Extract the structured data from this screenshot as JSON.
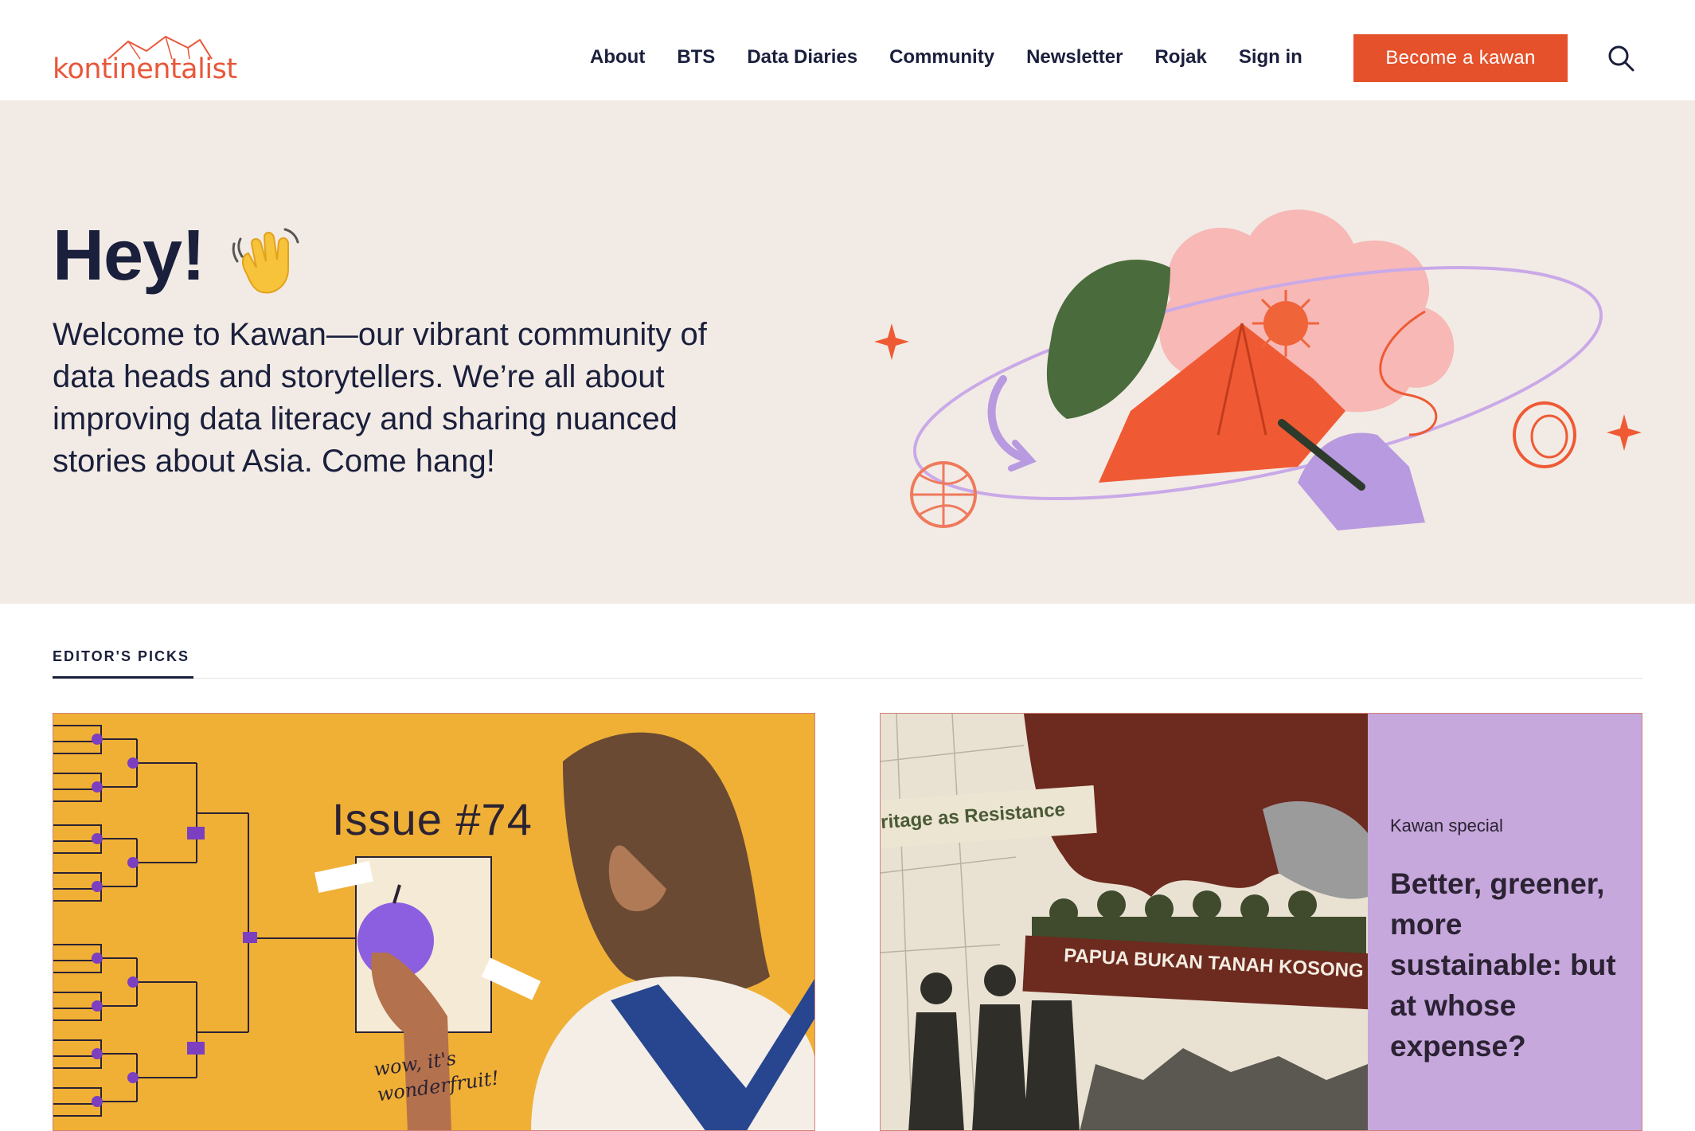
{
  "brand": {
    "logo_text": "kontinentalist",
    "accent": "#e4512a"
  },
  "nav": {
    "items": [
      "About",
      "BTS",
      "Data Diaries",
      "Community",
      "Newsletter",
      "Rojak",
      "Sign in"
    ],
    "cta_label": "Become a kawan",
    "search_icon": "search-icon"
  },
  "hero": {
    "title": "Hey!",
    "emoji": "waving-hand-icon",
    "text": "Welcome to Kawan—our vibrant community of data heads and storytellers. We’re all about improving data literacy and sharing nuanced stories about Asia. Come hang!"
  },
  "editors_picks": {
    "label": "EDITOR'S PICKS",
    "cards": [
      {
        "title": "Issue #74",
        "note": "wow, it's\nwonderfruit!"
      },
      {
        "strip": "ritage as Resistance",
        "banner": "PAPUA BUKAN TANAH KOSONG",
        "tag": "Kawan special",
        "headline": "Better, greener, more sustainable: but at whose expense?"
      }
    ]
  }
}
